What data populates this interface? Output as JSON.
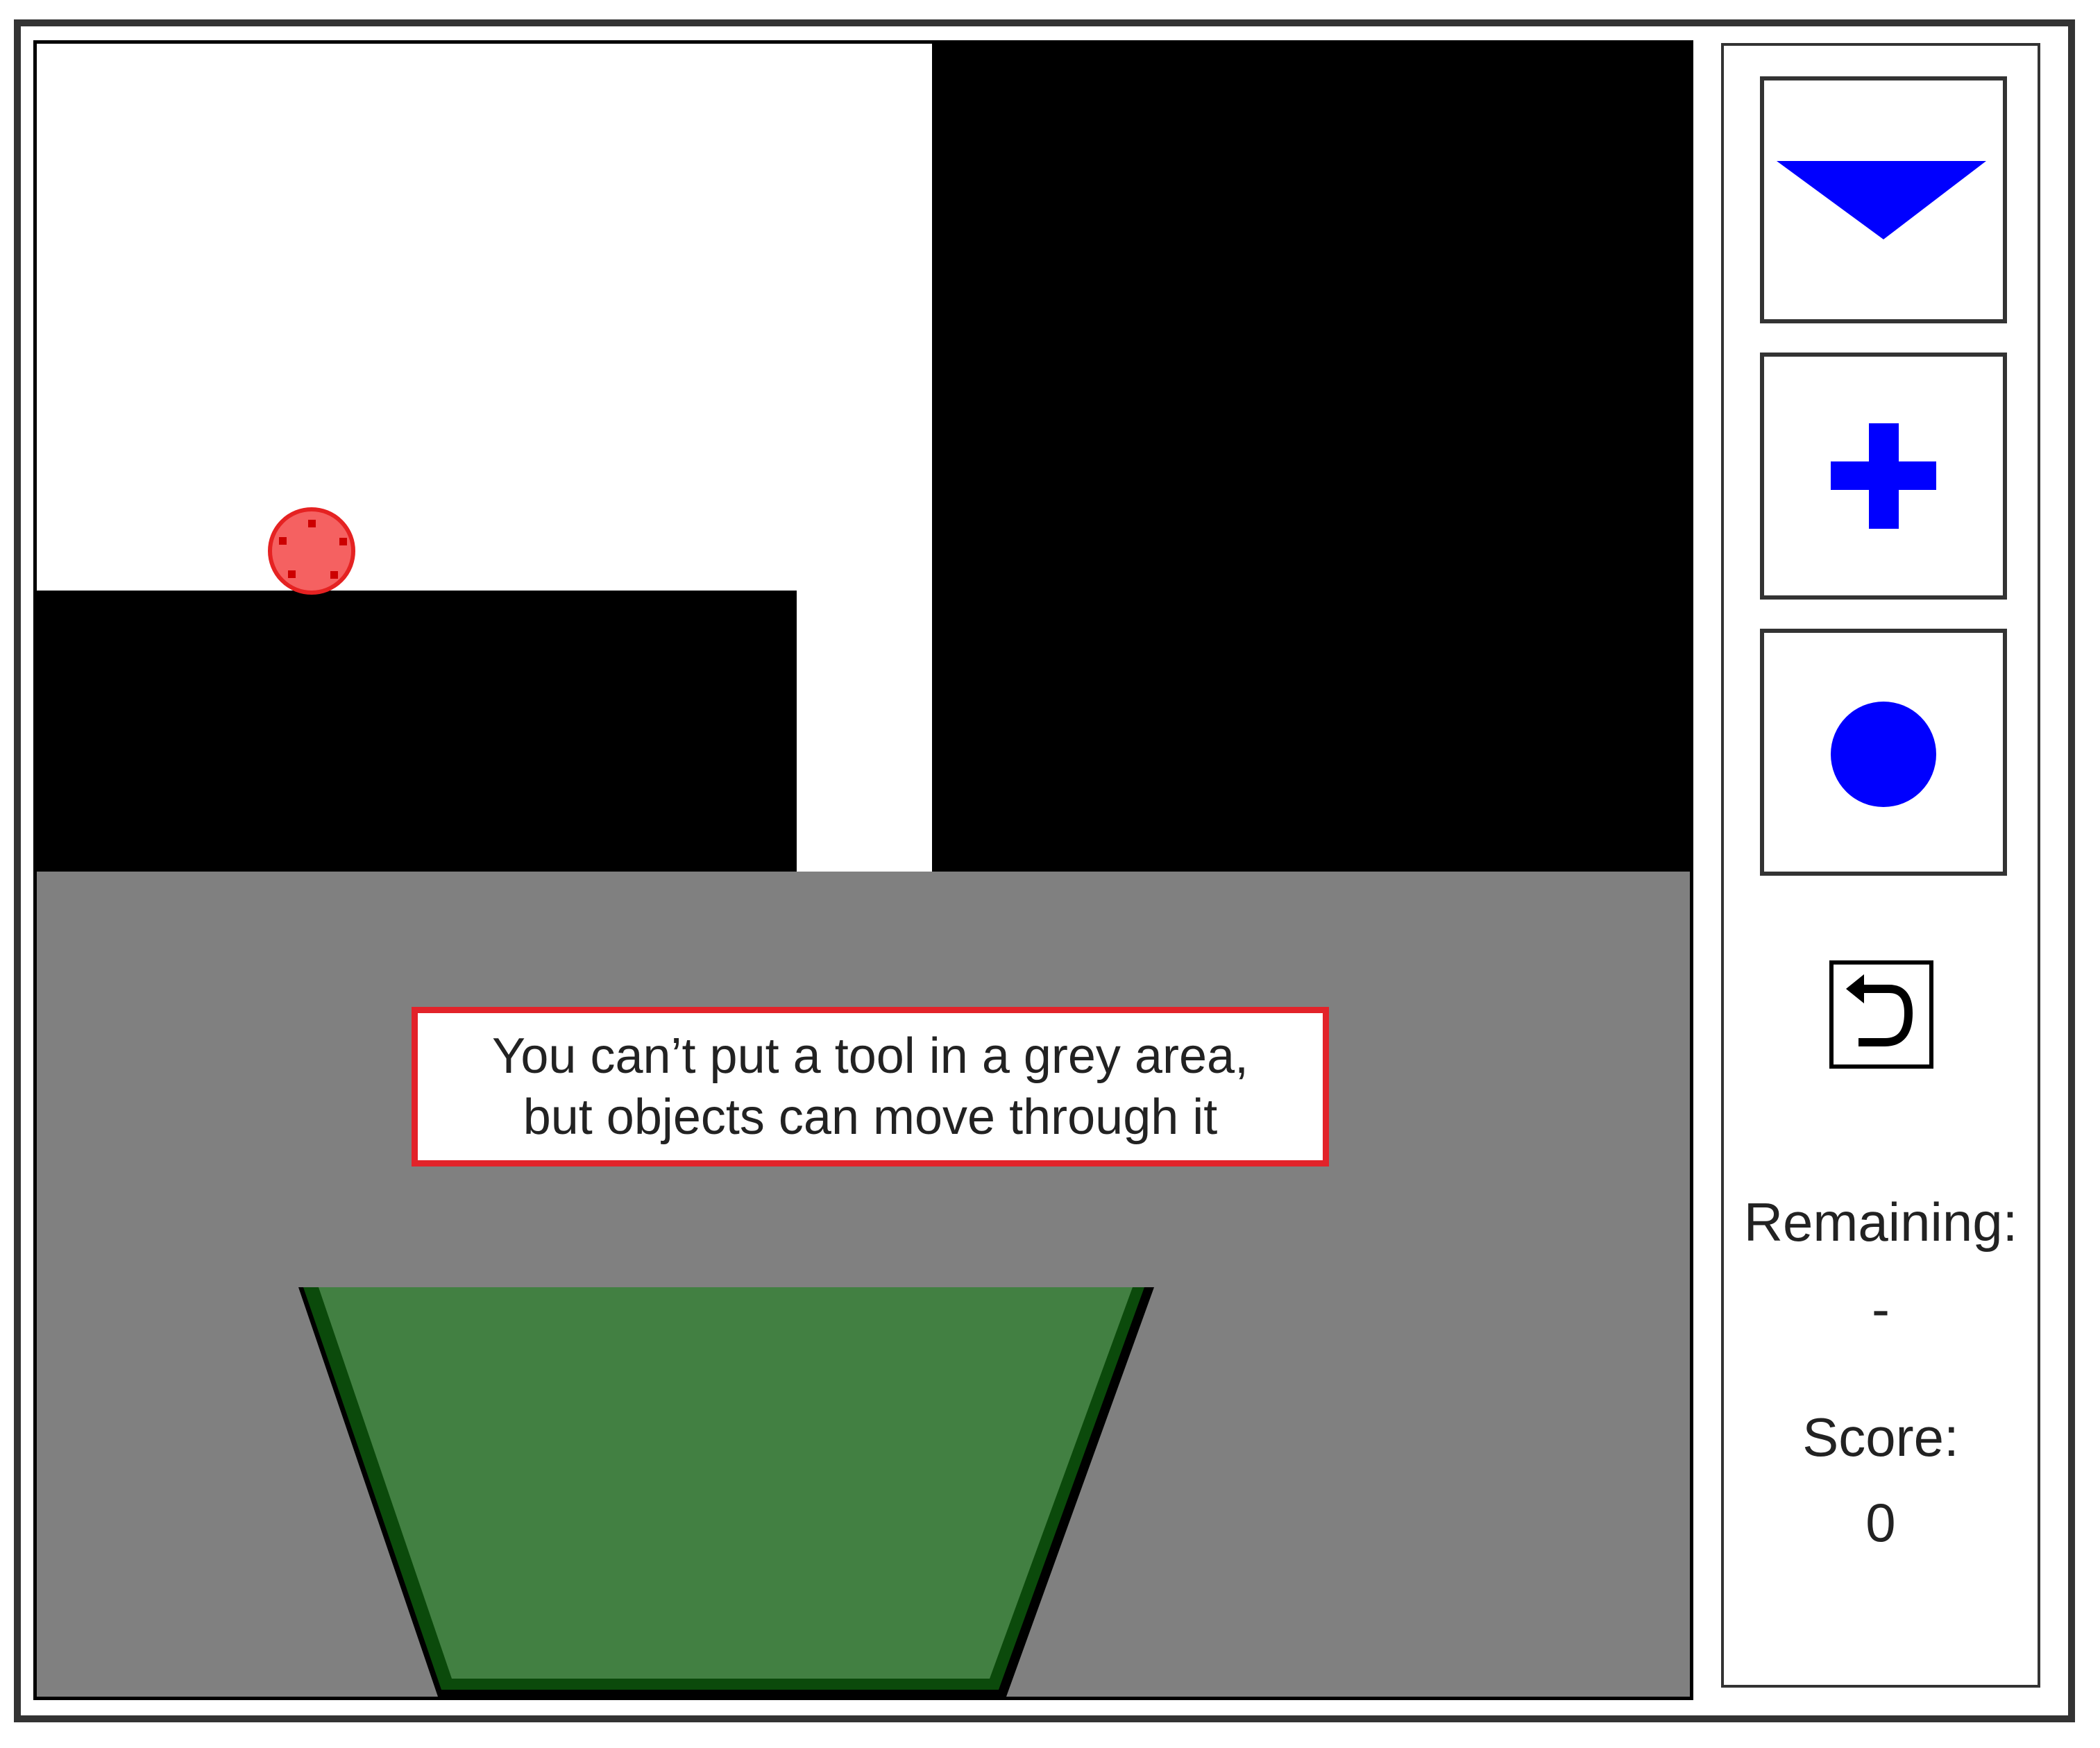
{
  "hint": {
    "text": "You can’t put a tool in a grey area,\nbut objects can move through it"
  },
  "tools": [
    {
      "name": "down-triangle-tool",
      "icon": "triangle-icon",
      "color": "#0000ff"
    },
    {
      "name": "plus-tool",
      "icon": "plus-icon",
      "color": "#0000ff"
    },
    {
      "name": "circle-tool",
      "icon": "circle-icon",
      "color": "#0000ff"
    }
  ],
  "reset": {
    "icon": "reset-arrow-icon"
  },
  "stats": {
    "remaining_label": "Remaining:",
    "remaining_value": "-",
    "score_label": "Score:",
    "score_value": "0"
  },
  "colors": {
    "wall": "#000000",
    "forbidden_area": "#808080",
    "goal_fill": "#428042",
    "goal_border": "#0b4a0b",
    "ball_fill": "#f56161",
    "ball_border": "#e52222",
    "hint_border": "#e2232a",
    "tool_color": "#0000ff"
  }
}
